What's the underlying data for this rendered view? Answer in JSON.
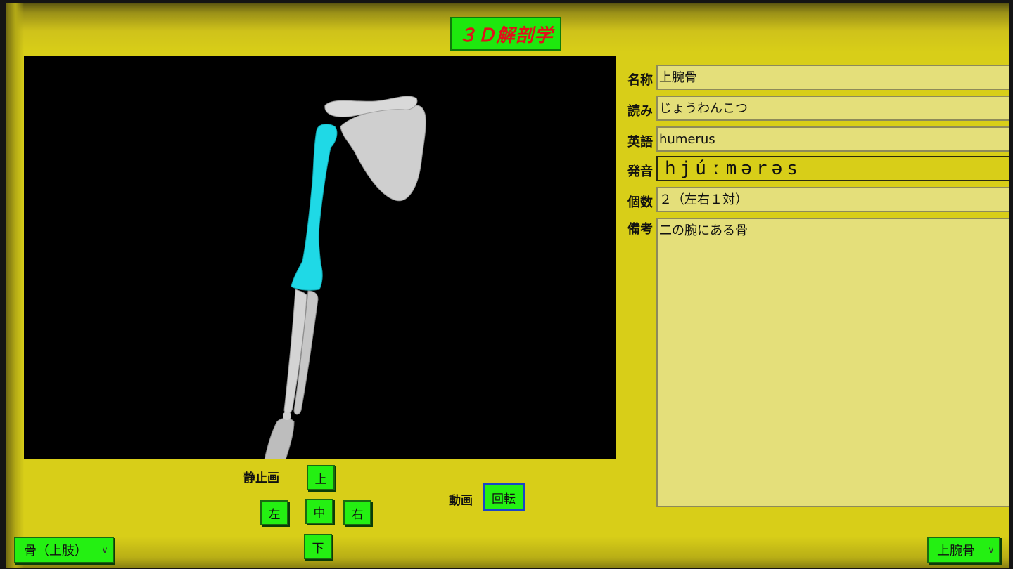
{
  "app": {
    "title": "３Ｄ解剖学"
  },
  "viewer": {
    "highlight_color": "#1fd9e6",
    "bone_color": "#d0d0d0"
  },
  "controls": {
    "still_label": "静止画",
    "up": "上",
    "left": "左",
    "center": "中",
    "right": "右",
    "down": "下",
    "motion_label": "動画",
    "rotate": "回転"
  },
  "info": {
    "name_label": "名称",
    "name_value": "上腕骨",
    "reading_label": "読み",
    "reading_value": "じょうわんこつ",
    "english_label": "英語",
    "english_value": "humerus",
    "pronunciation_label": "発音",
    "pronunciation_value": "hjúːmərəs",
    "count_label": "個数",
    "count_value": "２（左右１対）",
    "note_label": "備考",
    "note_value": "二の腕にある骨"
  },
  "selectors": {
    "category_value": "骨（上肢）",
    "item_value": "上腕骨"
  },
  "colors": {
    "accent": "#24f012",
    "background": "#d8ce18",
    "title_text": "#e0121a"
  }
}
